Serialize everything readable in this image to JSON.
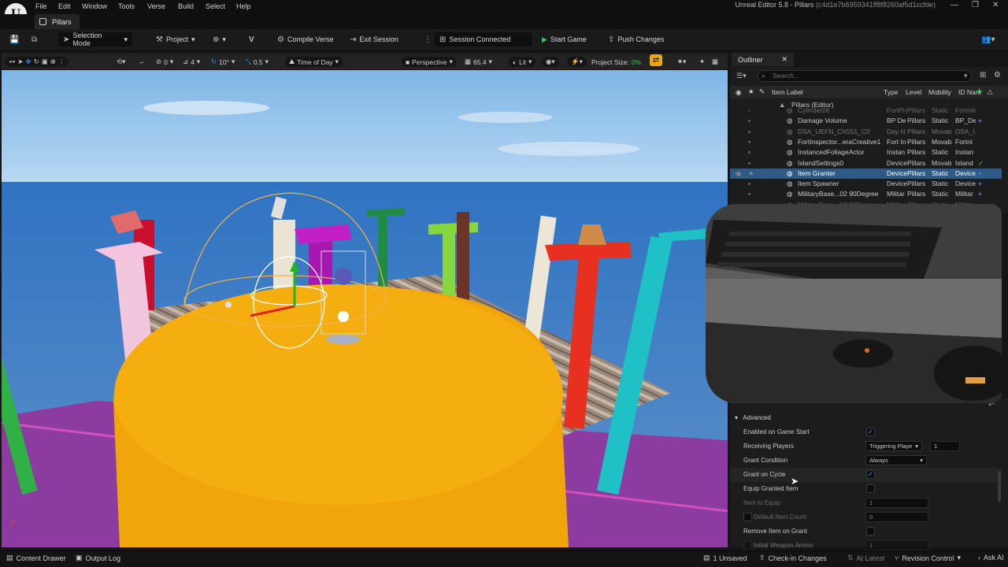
{
  "window": {
    "title": "Unreal Editor 5.8 - Pillars",
    "project_id": "(c4d1e7b6959341ff8f8260af5d1ccfde)"
  },
  "menu": [
    "File",
    "Edit",
    "Window",
    "Tools",
    "Verse",
    "Build",
    "Select",
    "Help"
  ],
  "tab": {
    "label": "Pillars"
  },
  "toolbar": {
    "selection_mode": "Selection Mode",
    "project": "Project",
    "compile_verse": "Compile Verse",
    "exit_session": "Exit Session",
    "session_status": "Session Connected",
    "start_game": "Start Game",
    "push_changes": "Push Changes"
  },
  "viewport_toolbar": {
    "rotation_snap_a": "0",
    "scale_snap_a": "4",
    "angle_snap": "10°",
    "scale_snap": "0.5",
    "time_of_day": "Time of Day",
    "perspective": "Perspective",
    "fov": "65.4",
    "lit": "Lit",
    "project_size_label": "Project Size:",
    "project_size_value": "0%"
  },
  "outliner": {
    "tab_label": "Outliner",
    "search_placeholder": "Search...",
    "columns": [
      "Item Label",
      "Type",
      "Level",
      "Mobility",
      "ID Nam"
    ],
    "root": "Pillars (Editor)",
    "rows": [
      {
        "label": "Cylinder06",
        "type": "FortPro",
        "level": "Pillars",
        "mobility": "Static",
        "id": "Fortnite",
        "badge": "",
        "dim": false,
        "faded": true
      },
      {
        "label": "Damage Volume",
        "type": "BP De",
        "level": "Pillars",
        "mobility": "Static",
        "id": "BP_De",
        "badge": "plus",
        "dim": false
      },
      {
        "label": "DSA_UEFN_Ch5S1_C0",
        "type": "Day N",
        "level": "Pillars",
        "mobility": "Movab",
        "id": "DSA_U",
        "badge": "",
        "dim": true
      },
      {
        "label": "FortInspector...eraCreative1",
        "type": "Fort In",
        "level": "Pillars",
        "mobility": "Movab",
        "id": "Fortni",
        "badge": "",
        "dim": false
      },
      {
        "label": "InstancedFoliageActor",
        "type": "Instan",
        "level": "Pillars",
        "mobility": "Static",
        "id": "Instan",
        "badge": "",
        "dim": false
      },
      {
        "label": "IslandSettings0",
        "type": "Device",
        "level": "Pillars",
        "mobility": "Movab",
        "id": "Island",
        "badge": "check",
        "dim": false
      },
      {
        "label": "Item Granter",
        "type": "Device",
        "level": "Pillars",
        "mobility": "Static",
        "id": "Device",
        "badge": "plus",
        "dim": false,
        "selected": true
      },
      {
        "label": "Item Spawner",
        "type": "Device",
        "level": "Pillars",
        "mobility": "Static",
        "id": "Device",
        "badge": "plus",
        "dim": false
      },
      {
        "label": "MilitaryBase...02 90Degree",
        "type": "Militar",
        "level": "Pillars",
        "mobility": "Static",
        "id": "Militar",
        "badge": "plus",
        "dim": false
      },
      {
        "label": "MilitaryBase...02 90Degree",
        "type": "Militar",
        "level": "Pillars",
        "mobility": "Static",
        "id": "Militar",
        "badge": "plus",
        "dim": false,
        "faded": true
      }
    ]
  },
  "details": {
    "section": "Advanced",
    "rows": [
      {
        "label": "Enabled on Game Start",
        "kind": "check",
        "checked": true,
        "dim": false
      },
      {
        "label": "Receiving Players",
        "kind": "dropdown-num",
        "value": "Triggering Playe",
        "num": "1",
        "dim": false
      },
      {
        "label": "Grant Condition",
        "kind": "dropdown",
        "value": "Always",
        "dim": false
      },
      {
        "label": "Grant on Cycle",
        "kind": "check",
        "checked": true,
        "dim": false,
        "hover": true
      },
      {
        "label": "Equip Granted Item",
        "kind": "check",
        "checked": false,
        "dim": false
      },
      {
        "label": "Item to Equip",
        "kind": "num",
        "num": "1",
        "dim": true
      },
      {
        "label": "Default Item Count",
        "kind": "num-check",
        "num": "0",
        "dim": true
      },
      {
        "label": "Remove Item on Grant",
        "kind": "check",
        "checked": false,
        "dim": false
      },
      {
        "label": "Initial Weapon Ammo",
        "kind": "num-check",
        "num": "1",
        "dim": false,
        "faded": true
      }
    ]
  },
  "statusbar": {
    "content_drawer": "Content Drawer",
    "output_log": "Output Log",
    "unsaved": "1 Unsaved",
    "checkin": "Check-in Changes",
    "at_latest": "At Latest",
    "revision_control": "Revision Control",
    "ask_ai": "Ask AI"
  },
  "colors": {
    "selection": "#2d5a87",
    "accent_blue": "#3b8cff",
    "play_green": "#3ec35a",
    "platform_orange": "#f5ae0f",
    "project_size_amber": "#e8a814"
  },
  "icons": [
    "unreal-logo-icon",
    "save-icon",
    "content-icon",
    "cursor-icon",
    "move-icon",
    "rotate-icon",
    "scale-icon",
    "globe-icon",
    "camera-icon",
    "eye-icon",
    "gear-icon",
    "search-icon",
    "plus-icon",
    "check-icon",
    "filter-icon"
  ]
}
